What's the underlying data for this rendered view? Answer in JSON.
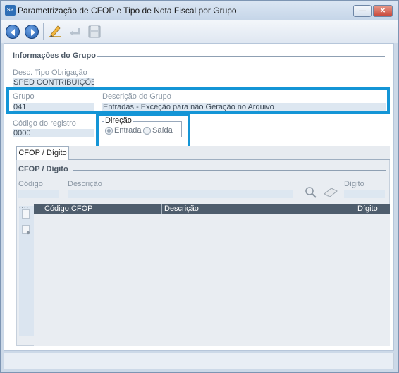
{
  "window": {
    "app_icon_text": "SP",
    "title": "Parametrização de CFOP e Tipo de Nota Fiscal por Grupo",
    "minimize_glyph": "—",
    "close_glyph": "✕"
  },
  "toolbar": {
    "buttons": [
      {
        "icon": "back-arrow-icon",
        "enabled": true
      },
      {
        "icon": "forward-arrow-icon",
        "enabled": true
      },
      {
        "icon": "edit-pencil-icon",
        "enabled": true
      },
      {
        "icon": "undo-icon",
        "enabled": false
      },
      {
        "icon": "save-disk-icon",
        "enabled": false
      }
    ]
  },
  "group_info": {
    "section_title": "Informações do Grupo",
    "tipo_obrigacao_label": "Desc. Tipo Obrigação",
    "tipo_obrigacao_value": "SPED CONTRIBUIÇÕES",
    "grupo_label": "Grupo",
    "grupo_value": "041",
    "descricao_label": "Descrição do Grupo",
    "descricao_value": "Entradas - Exceção para não Geração no Arquivo",
    "codigo_registro_label": "Código do registro",
    "codigo_registro_value": "0000",
    "direcao_label": "Direção",
    "direcao_options": [
      "Entrada",
      "Saída"
    ],
    "direcao_selected": "Entrada"
  },
  "tabs": [
    {
      "label": "CFOP / Dígito",
      "active": true
    }
  ],
  "cfop_panel": {
    "section_title": "CFOP / Dígito",
    "codigo_label": "Código",
    "descricao_label": "Descrição",
    "digito_label": "Dígito",
    "grid_columns": [
      "Código CFOP",
      "Descrição",
      "Dígito"
    ],
    "rows": []
  },
  "colors": {
    "highlight": "#1495d6",
    "grid_header": "#4e5d6d",
    "field_bg": "#dde7f1"
  }
}
